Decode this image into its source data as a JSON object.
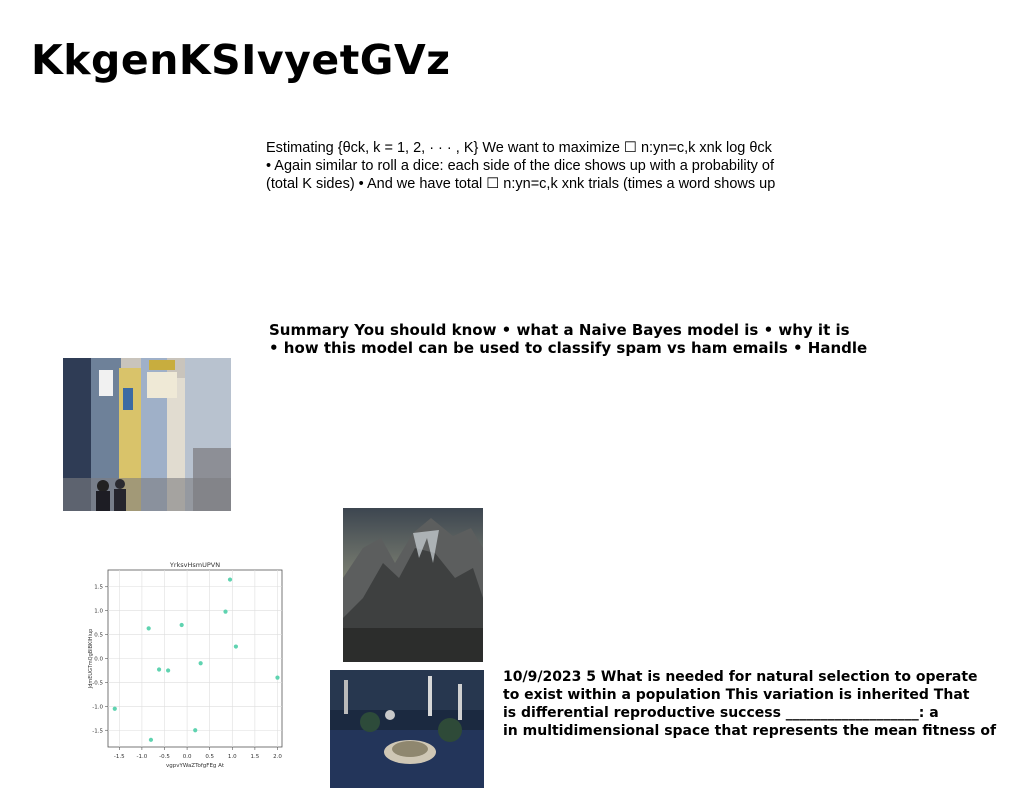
{
  "page": {
    "title": "KkgenKSIvyetGVz"
  },
  "paragraphs": {
    "estimating": [
      "Estimating {θck, k = 1, 2, · · · , K} We want to maximize ☐ n:yn=c,k xnk log θck",
      "• Again similar to roll a dice: each side of the dice shows up with a probability of",
      "(total K sides) • And we have total ☐ n:yn=c,k xnk trials (times a word shows up"
    ],
    "summary": [
      "Summary You should know • what a Naive Bayes model is • why it is",
      "• how this model can be used to classify spam vs ham emails • Handle"
    ],
    "selection": [
      "10/9/2023 5 What is needed for natural selection to operate",
      "to exist within a population This variation is inherited That",
      "is differential reproductive success ___________________: a",
      "in multidimensional space that represents the mean fitness of"
    ]
  },
  "chart_data": {
    "type": "scatter",
    "title": "YrksvHsmUPVN",
    "xlabel": "vgpvYWaZTofgFEg At",
    "ylabel": "JdmEUGTmQgBlBKIHiup",
    "xlim": [
      -1.75,
      2.1
    ],
    "ylim": [
      -1.85,
      1.85
    ],
    "xticks": [
      -1.5,
      -1.0,
      -0.5,
      0.0,
      0.5,
      1.0,
      1.5,
      2.0
    ],
    "xtick_labels": [
      "-1.5",
      "-1.0",
      "-0.5",
      "0.0",
      "0.5",
      "1.0",
      "1.5",
      "2.0"
    ],
    "yticks": [
      -1.5,
      -1.0,
      -0.5,
      0.0,
      0.5,
      1.0,
      1.5
    ],
    "ytick_labels": [
      "-1.5",
      "-1.0",
      "-0.5",
      "0.0",
      "0.5",
      "1.0",
      "1.5"
    ],
    "grid": true,
    "color": "#5fd3b0",
    "x": [
      -1.6,
      -0.85,
      -0.8,
      -0.62,
      -0.42,
      -0.12,
      0.18,
      0.3,
      0.85,
      0.95,
      1.08,
      2.0
    ],
    "y": [
      -1.05,
      0.63,
      -1.7,
      -0.23,
      -0.25,
      0.7,
      -1.5,
      -0.1,
      0.98,
      1.65,
      0.25,
      -0.4
    ]
  }
}
